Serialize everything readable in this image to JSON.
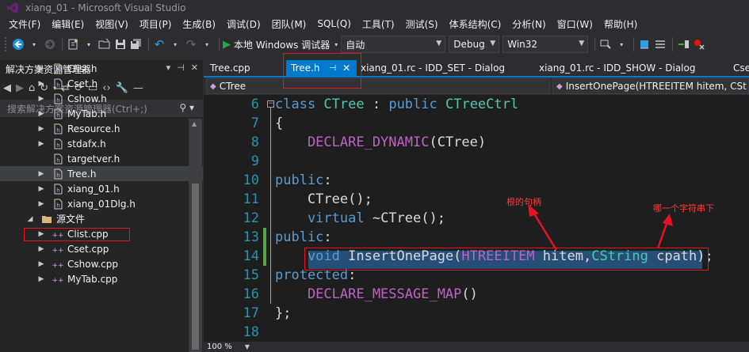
{
  "window": {
    "title": "xiang_01 - Microsoft Visual Studio"
  },
  "menu": [
    "文件(F)",
    "编辑(E)",
    "视图(V)",
    "项目(P)",
    "生成(B)",
    "调试(D)",
    "团队(M)",
    "SQL(Q)",
    "工具(T)",
    "测试(S)",
    "体系结构(C)",
    "分析(N)",
    "窗口(W)",
    "帮助(H)"
  ],
  "toolbar": {
    "run_label": "本地 Windows 调试器",
    "config_combo": "自动",
    "build_config": "Debug",
    "platform": "Win32"
  },
  "solution_explorer": {
    "title": "解决方案资源管理器",
    "header_icons": [
      "▾",
      "⊣",
      "✕"
    ],
    "search_placeholder": "搜索解决方案资源管理器(Ctrl+;)",
    "items": [
      {
        "label": "Clist.h",
        "icon": "header-file-icon"
      },
      {
        "label": "Cset.h",
        "icon": "header-file-icon"
      },
      {
        "label": "Cshow.h",
        "icon": "header-file-icon"
      },
      {
        "label": "MyTab.h",
        "icon": "header-file-icon"
      },
      {
        "label": "Resource.h",
        "icon": "header-file-icon"
      },
      {
        "label": "stdafx.h",
        "icon": "header-file-icon"
      },
      {
        "label": "targetver.h",
        "icon": "header-file-icon"
      },
      {
        "label": "Tree.h",
        "icon": "header-file-icon"
      },
      {
        "label": "xiang_01.h",
        "icon": "header-file-icon"
      },
      {
        "label": "xiang_01Dlg.h",
        "icon": "header-file-icon"
      },
      {
        "label": "源文件",
        "icon": "folder-icon"
      },
      {
        "label": "Clist.cpp",
        "icon": "cpp-file-icon"
      },
      {
        "label": "Cset.cpp",
        "icon": "cpp-file-icon"
      },
      {
        "label": "Cshow.cpp",
        "icon": "cpp-file-icon"
      },
      {
        "label": "MyTab.cpp",
        "icon": "cpp-file-icon"
      }
    ]
  },
  "tabs": [
    {
      "label": "Tree.cpp"
    },
    {
      "label": "Tree.h",
      "active": true
    },
    {
      "label": "xiang_01.rc - IDD_SET - Dialog"
    },
    {
      "label": "xiang_01.rc - IDD_SHOW - Dialog"
    },
    {
      "label": "Cse"
    }
  ],
  "navbar": {
    "scope": "CTree",
    "member": "InsertOnePage(HTREEITEM hitem, CSt"
  },
  "editor": {
    "zoom": "100 %",
    "lines": [
      {
        "no": "6",
        "tokens": [
          {
            "t": "class ",
            "c": "kw"
          },
          {
            "t": "CTree",
            "c": "cls"
          },
          {
            "t": " : ",
            "c": "plain"
          },
          {
            "t": "public ",
            "c": "kw"
          },
          {
            "t": "CTreeCtrl",
            "c": "cls"
          }
        ]
      },
      {
        "no": "7",
        "tokens": [
          {
            "t": "{",
            "c": "plain"
          }
        ]
      },
      {
        "no": "8",
        "tokens": [
          {
            "t": "    DECLARE_DYNAMIC",
            "c": "macro"
          },
          {
            "t": "(CTree)",
            "c": "plain"
          }
        ]
      },
      {
        "no": "9",
        "tokens": [
          {
            "t": "",
            "c": "plain"
          }
        ]
      },
      {
        "no": "10",
        "tokens": [
          {
            "t": "public",
            "c": "kw"
          },
          {
            "t": ":",
            "c": "plain"
          }
        ]
      },
      {
        "no": "11",
        "tokens": [
          {
            "t": "    CTree();",
            "c": "plain"
          }
        ]
      },
      {
        "no": "12",
        "tokens": [
          {
            "t": "    virtual ",
            "c": "kw"
          },
          {
            "t": "~CTree();",
            "c": "plain"
          }
        ]
      },
      {
        "no": "13",
        "tokens": [
          {
            "t": "public",
            "c": "kw"
          },
          {
            "t": ":",
            "c": "plain"
          }
        ]
      },
      {
        "no": "14",
        "tokens": [
          {
            "t": "    void ",
            "c": "kw"
          },
          {
            "t": "InsertOnePage(",
            "c": "plain"
          },
          {
            "t": "HTREEITEM",
            "c": "macro"
          },
          {
            "t": " hitem,",
            "c": "plain"
          },
          {
            "t": "CString",
            "c": "cls"
          },
          {
            "t": " cpath);",
            "c": "plain"
          }
        ]
      },
      {
        "no": "15",
        "tokens": [
          {
            "t": "protected",
            "c": "kw"
          },
          {
            "t": ":",
            "c": "plain"
          }
        ]
      },
      {
        "no": "16",
        "tokens": [
          {
            "t": "    DECLARE_MESSAGE_MAP",
            "c": "macro"
          },
          {
            "t": "()",
            "c": "plain"
          }
        ]
      },
      {
        "no": "17",
        "tokens": [
          {
            "t": "};",
            "c": "plain"
          }
        ]
      },
      {
        "no": "18",
        "tokens": [
          {
            "t": "",
            "c": "plain"
          }
        ]
      }
    ]
  },
  "annotations": {
    "left": "根的句柄",
    "right": "哪一个字符串下"
  },
  "colors": {
    "accent": "#007acc",
    "annotation": "#e81123"
  }
}
